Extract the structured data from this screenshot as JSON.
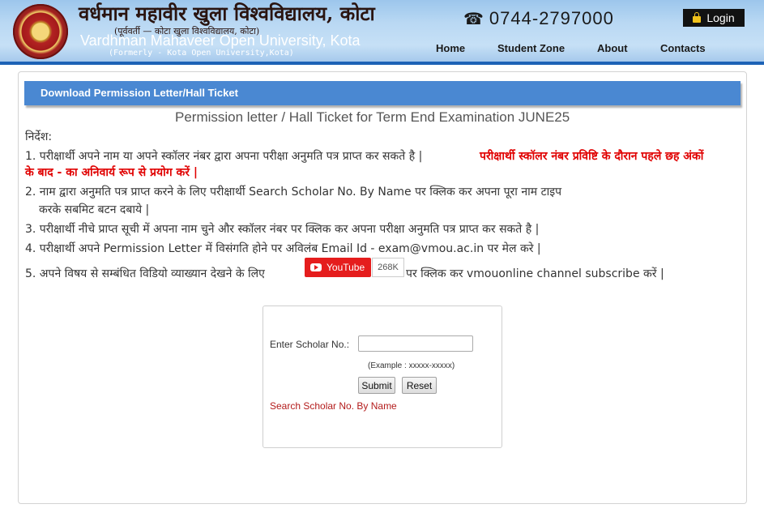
{
  "header": {
    "hindi_title": "वर्धमान महावीर खुला विश्वविद्यालय, कोटा",
    "hindi_subtitle": "(पूर्ववर्ती — कोटा खुला विश्वविद्यालय, कोटा)",
    "english_title": "Vardhman Mahaveer Open University, Kota",
    "formerly": "(Formerly - Kota Open University,Kota)",
    "phone_icon": "☎",
    "phone": "0744-2797000",
    "login_label": "Login",
    "nav": [
      "Home",
      "Student Zone",
      "About",
      "Contacts"
    ]
  },
  "banner": {
    "label": "Download Permission Letter/Hall Ticket"
  },
  "page_title": "Permission letter / Hall Ticket for Term End Examination JUNE25",
  "instructions": {
    "heading": "निर्देश:",
    "item1_a": "1. परीक्षार्थी अपने नाम या अपने स्कॉलर नंबर द्वारा अपना परीक्षा अनुमति पत्र प्राप्त कर सकते है |",
    "item1_b": "परीक्षार्थी स्कॉलर नंबर प्रविष्टि के दौरान पहले छह अंकों",
    "item1_c": "के बाद - का अनिवार्य रूप से प्रयोग करें |",
    "item2_a": "2. नाम द्वारा अनुमति पत्र प्राप्त करने के लिए परीक्षार्थी Search Scholar No. By Name पर क्लिक कर अपना पूरा नाम टाइप",
    "item2_b": "करके सबमिट बटन दबाये |",
    "item3": "3. परीक्षार्थी नीचे प्राप्त सूची में अपना नाम चुने और स्कॉलर नंबर पर क्लिक कर अपना परीक्षा अनुमति पत्र प्राप्त कर सकते है |",
    "item4": "4. परीक्षार्थी अपने Permission Letter में विसंगति होने पर अविलंब Email Id - exam@vmou.ac.in पर मेल करे |",
    "item5_a": "5. अपने विषय से सम्बंधित विडियो व्याख्यान देखने के लिए",
    "item5_b": "पर क्लिक कर vmouonline channel subscribe करें |"
  },
  "youtube": {
    "label": "YouTube",
    "count": "268K"
  },
  "form": {
    "scholar_label": "Enter Scholar No.:",
    "scholar_value": "",
    "example": "(Example :  xxxxx-xxxxx)",
    "submit_label": "Submit",
    "reset_label": "Reset",
    "search_link": "Search Scholar No. By Name"
  }
}
